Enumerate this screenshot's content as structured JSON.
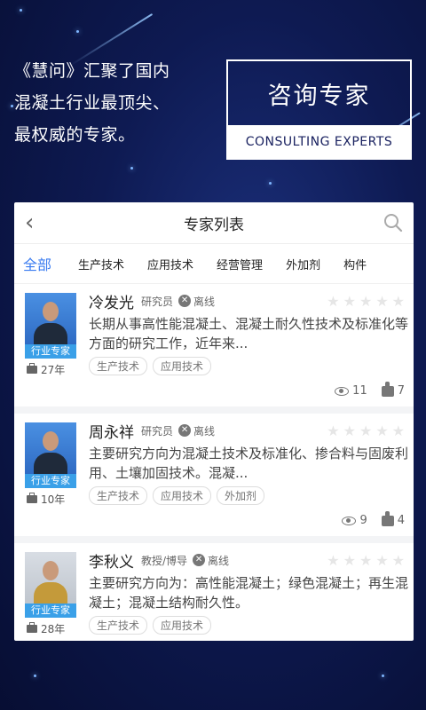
{
  "promo": {
    "lines": [
      "《慧问》汇聚了国内",
      "混凝土行业最顶尖、",
      "最权威的专家。"
    ]
  },
  "badge": {
    "title": "咨询专家",
    "subtitle": "CONSULTING  EXPERTS"
  },
  "app": {
    "nav": {
      "title": "专家列表",
      "back_icon": "chevron-left-icon",
      "search_icon": "search-icon"
    },
    "tabs": [
      {
        "label": "全部",
        "active": true
      },
      {
        "label": "生产技术",
        "active": false
      },
      {
        "label": "应用技术",
        "active": false
      },
      {
        "label": "经营管理",
        "active": false
      },
      {
        "label": "外加剂",
        "active": false
      },
      {
        "label": "构件",
        "active": false
      }
    ],
    "experts": [
      {
        "name": "冷发光",
        "title": "研究员",
        "status": "离线",
        "badge": "行业专家",
        "years": "27年",
        "desc": "长期从事高性能混凝土、混凝土耐久性技术及标准化等方面的研究工作，近年来...",
        "tags": [
          "生产技术",
          "应用技术"
        ],
        "views": "11",
        "likes": "7",
        "rating": 0
      },
      {
        "name": "周永祥",
        "title": "研究员",
        "status": "离线",
        "badge": "行业专家",
        "years": "10年",
        "desc": "主要研究方向为混凝土技术及标准化、掺合料与固废利用、土壤加固技术。混凝...",
        "tags": [
          "生产技术",
          "应用技术",
          "外加剂"
        ],
        "views": "9",
        "likes": "4",
        "rating": 0
      },
      {
        "name": "李秋义",
        "title": "教授/博导",
        "status": "离线",
        "badge": "行业专家",
        "years": "28年",
        "desc": "主要研究方向为：高性能混凝土；绿色混凝土；再生混凝土；混凝土结构耐久性。",
        "tags": [
          "生产技术",
          "应用技术"
        ],
        "views": "",
        "likes": "",
        "rating": 0
      }
    ]
  },
  "colors": {
    "accent": "#3a7bf0",
    "badge_blue": "#3aa0e8",
    "background": "#0e1a52"
  }
}
